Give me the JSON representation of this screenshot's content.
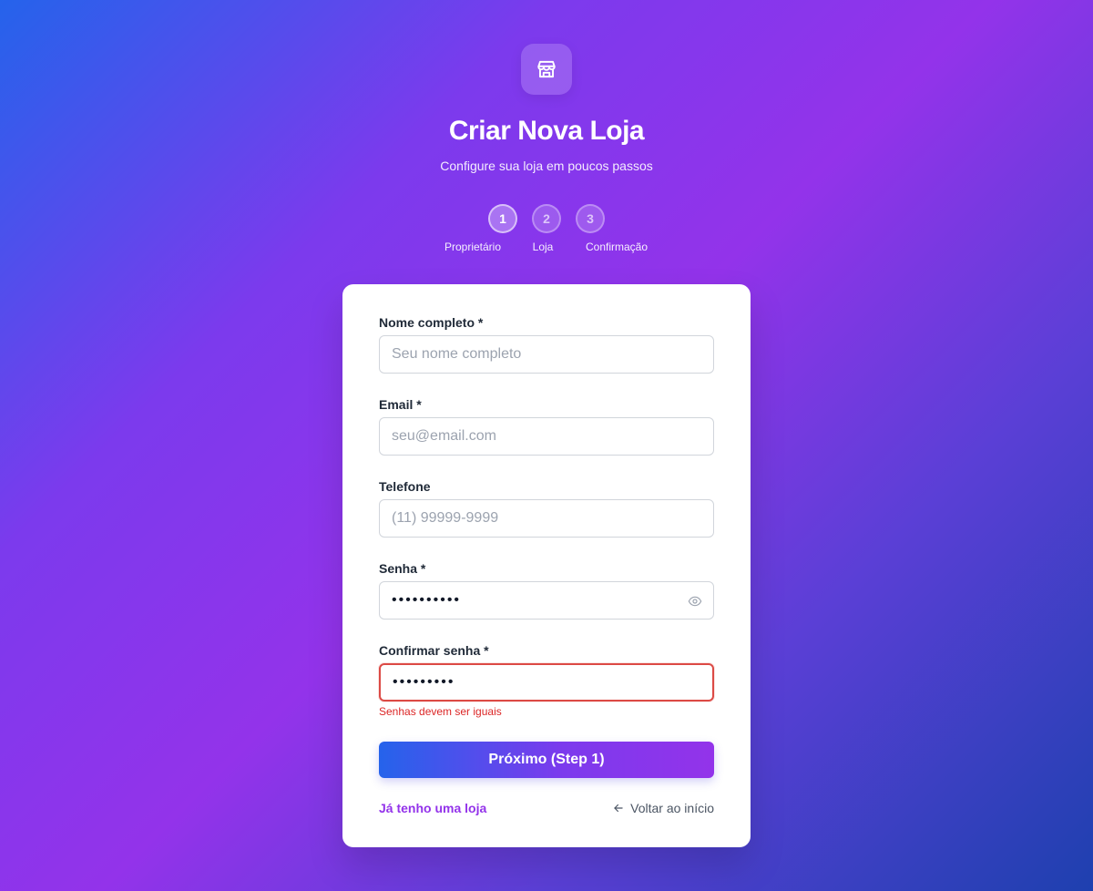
{
  "header": {
    "logo_icon": "store-icon",
    "title": "Criar Nova Loja",
    "subtitle": "Configure sua loja em poucos passos"
  },
  "steps": [
    {
      "number": "1",
      "label": "Proprietário",
      "active": true
    },
    {
      "number": "2",
      "label": "Loja",
      "active": false
    },
    {
      "number": "3",
      "label": "Confirmação",
      "active": false
    }
  ],
  "form": {
    "name": {
      "label": "Nome completo *",
      "placeholder": "Seu nome completo",
      "value": ""
    },
    "email": {
      "label": "Email *",
      "placeholder": "seu@email.com",
      "value": ""
    },
    "phone": {
      "label": "Telefone",
      "placeholder": "(11) 99999-9999",
      "value": ""
    },
    "password": {
      "label": "Senha *",
      "value": "••••••••••",
      "toggle_icon": "eye-icon"
    },
    "confirm_password": {
      "label": "Confirmar senha *",
      "value": "•••••••••",
      "error": "Senhas devem ser iguais"
    },
    "submit_label": "Próximo (Step 1)"
  },
  "footer": {
    "existing_store_link": "Já tenho uma loja",
    "back_link": "Voltar ao início",
    "back_icon": "arrow-left-icon"
  },
  "colors": {
    "accent": "#9333ea",
    "primary": "#2563eb",
    "error": "#dc2626"
  }
}
